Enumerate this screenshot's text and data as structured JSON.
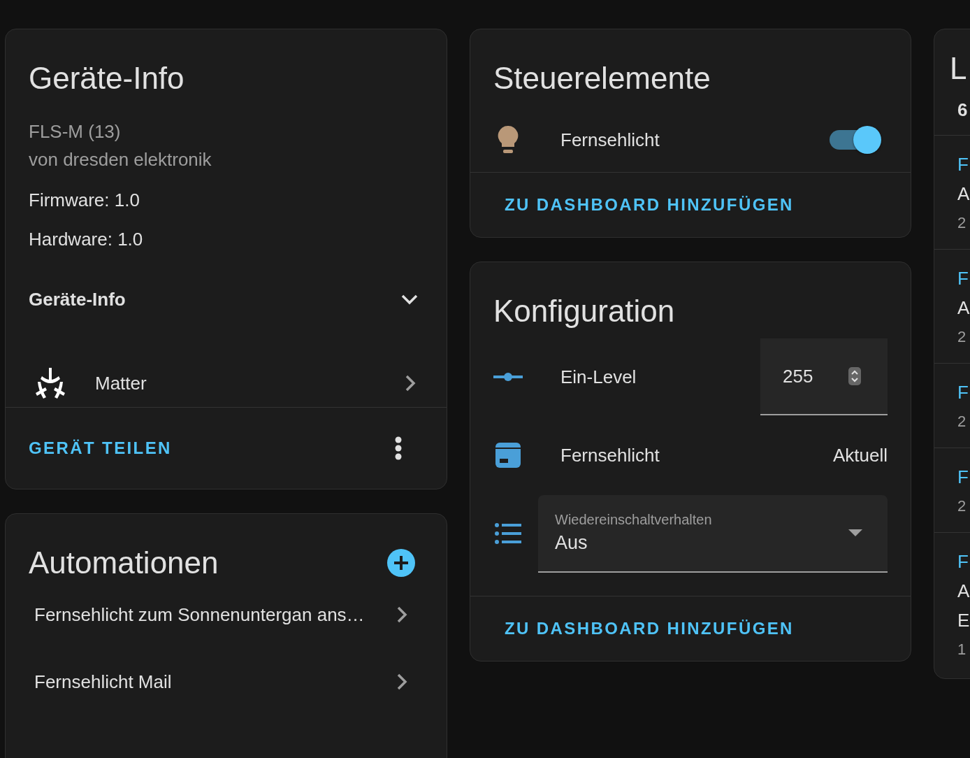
{
  "device_info": {
    "title": "Geräte-Info",
    "model": "FLS-M (13)",
    "manufacturer": "von dresden elektronik",
    "firmware": "Firmware: 1.0",
    "hardware": "Hardware: 1.0",
    "section": {
      "label": "Geräte-Info",
      "expanded": false
    },
    "integration": {
      "name": "Matter"
    },
    "action": "GERÄT TEILEN"
  },
  "automations": {
    "title": "Automationen",
    "items": [
      {
        "name": "Fernsehlicht zum Sonnenuntergan ans…"
      },
      {
        "name": "Fernsehlicht Mail"
      }
    ]
  },
  "controls": {
    "title": "Steuerelemente",
    "entities": [
      {
        "name": "Fernsehlicht",
        "on": true
      }
    ],
    "action": "ZU DASHBOARD HINZUFÜGEN"
  },
  "configuration": {
    "title": "Konfiguration",
    "rows": [
      {
        "kind": "number",
        "name": "Ein-Level",
        "value": "255"
      },
      {
        "kind": "update",
        "name": "Fernsehlicht",
        "value": "Aktuell"
      },
      {
        "kind": "select",
        "label": "Wiedereinschaltverhalten",
        "value": "Aus"
      }
    ],
    "action": "ZU DASHBOARD HINZUFÜGEN"
  },
  "logbook": {
    "title": "L",
    "count": "6",
    "entries": [
      {
        "title": "F",
        "lines": [
          "A",
          "2"
        ]
      },
      {
        "title": "F",
        "lines": [
          "A",
          "2"
        ]
      },
      {
        "title": "F",
        "lines": [
          "2"
        ]
      },
      {
        "title": "F",
        "lines": [
          "2"
        ]
      },
      {
        "title": "F",
        "lines": [
          "A",
          "E",
          "1"
        ]
      }
    ]
  }
}
